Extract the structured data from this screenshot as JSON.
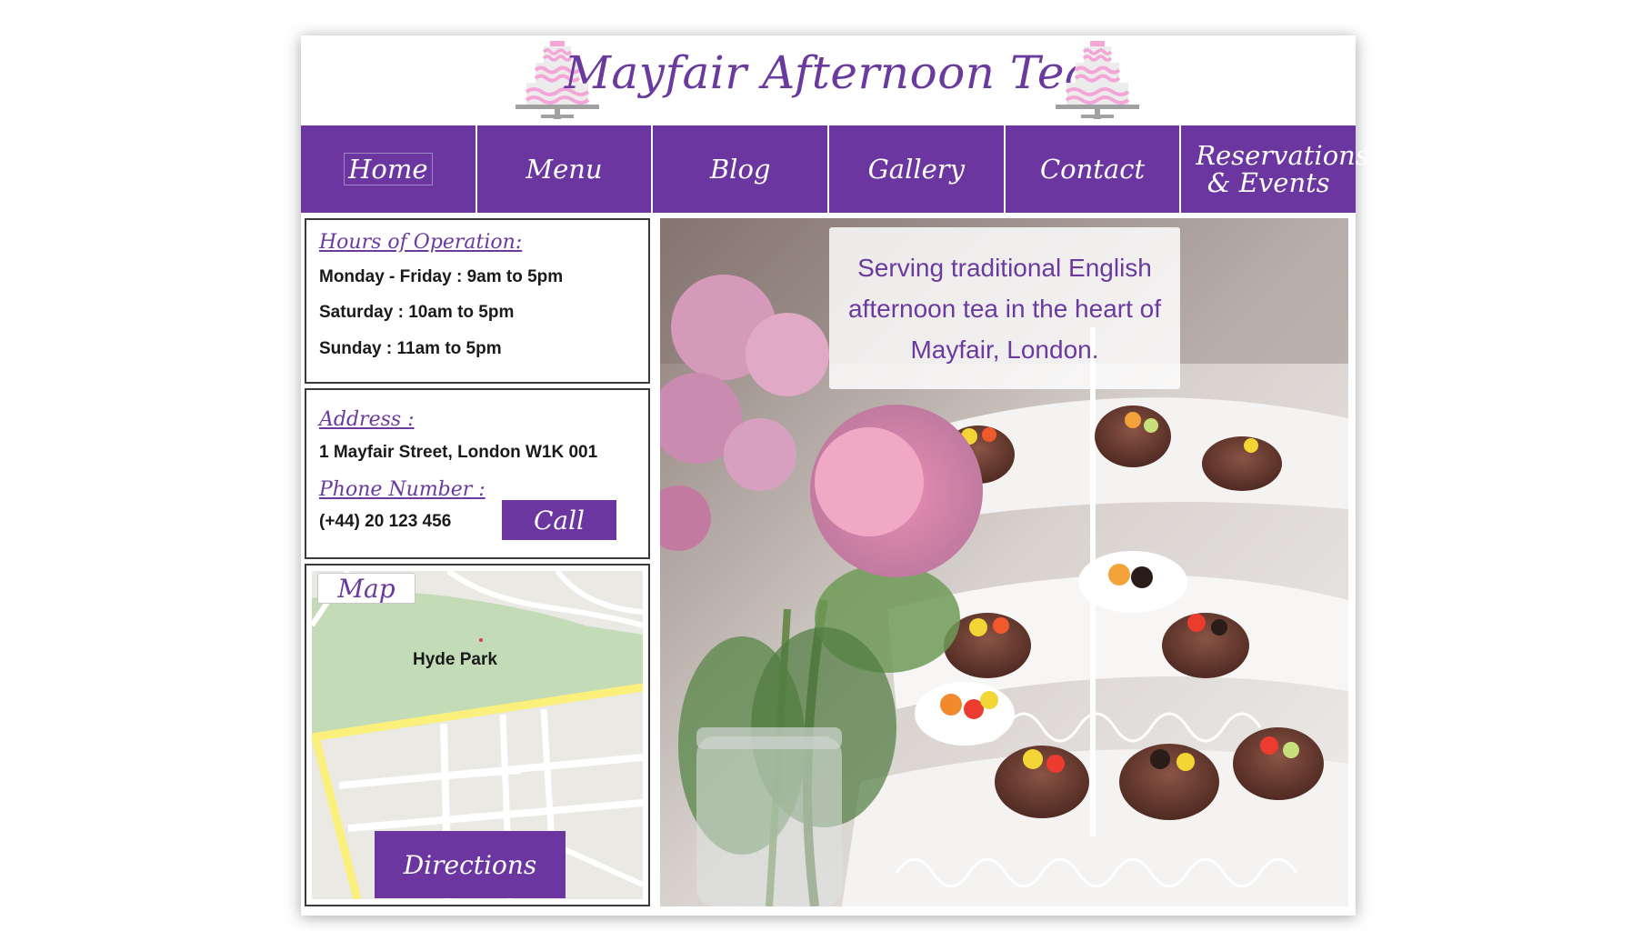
{
  "header": {
    "title": "Mayfair Afternoon Tea"
  },
  "nav": {
    "items": [
      {
        "label": "Home"
      },
      {
        "label": "Menu"
      },
      {
        "label": "Blog"
      },
      {
        "label": "Gallery"
      },
      {
        "label": "Contact"
      },
      {
        "label": "Reservations & Events"
      }
    ],
    "active": "Home"
  },
  "hours": {
    "heading": "Hours of Operation:",
    "lines": [
      "Monday - Friday : 9am to 5pm",
      "Saturday : 10am to 5pm",
      "Sunday : 11am to 5pm"
    ]
  },
  "contact": {
    "address_heading": "Address :",
    "address": "1 Mayfair Street, London W1K 001",
    "phone_heading": "Phone Number :",
    "phone": "(+44) 20 123 456",
    "call_label": "Call"
  },
  "map": {
    "tab_label": "Map",
    "park_label": "Hyde Park",
    "directions_label": "Directions"
  },
  "hero": {
    "tagline": "Serving traditional English afternoon tea in the heart of Mayfair, London."
  },
  "colors": {
    "brand_purple": "#6b36a0",
    "heading_purple": "#6a3a9e",
    "park_green": "#c3dbb7",
    "road_yellow": "#fbf07c"
  },
  "icons": {
    "logo": "cake-icon"
  }
}
